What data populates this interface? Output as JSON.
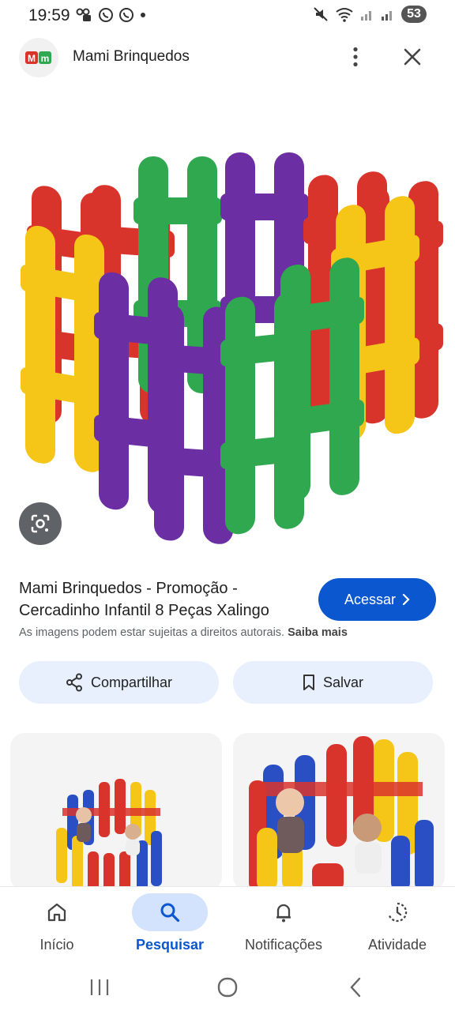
{
  "status_bar": {
    "time": "19:59",
    "battery": "53"
  },
  "header": {
    "site_logo_text": "Mm",
    "site_name": "Mami Brinquedos"
  },
  "result": {
    "title": "Mami Brinquedos - Promoção - Cercadinho Infantil 8 Peças Xalingo",
    "visit_label": "Acessar",
    "copyright_text": "As imagens podem estar sujeitas a direitos autorais.",
    "learn_more": "Saiba mais",
    "share_label": "Compartilhar",
    "save_label": "Salvar"
  },
  "bottom_nav": {
    "items": [
      {
        "label": "Início",
        "icon": "home-icon"
      },
      {
        "label": "Pesquisar",
        "icon": "search-icon"
      },
      {
        "label": "Notificações",
        "icon": "bell-icon"
      },
      {
        "label": "Atividade",
        "icon": "activity-icon"
      }
    ]
  },
  "colors": {
    "accent": "#0b57d0",
    "chip_bg": "#e8f0fe",
    "nav_active_bg": "#d3e3fd",
    "fence_red": "#d9342b",
    "fence_green": "#2fa84f",
    "fence_purple": "#6b2fa3",
    "fence_yellow": "#f5c518",
    "fence_blue": "#2a4fc4"
  }
}
